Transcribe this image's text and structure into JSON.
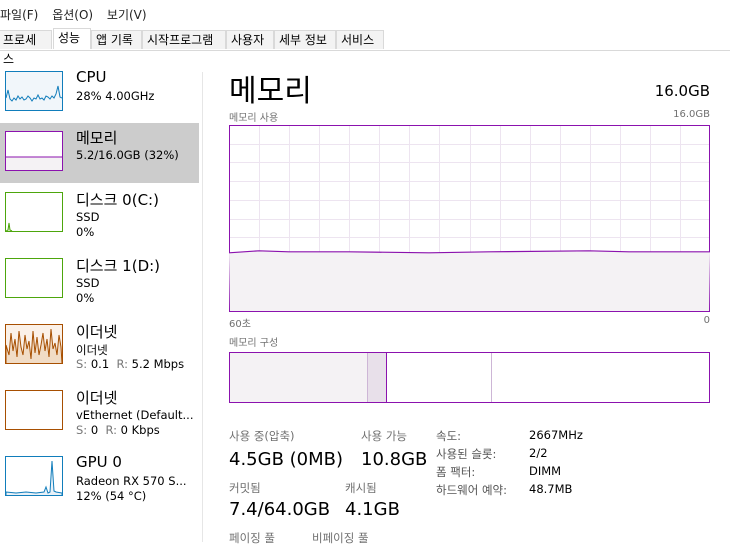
{
  "menu": [
    "파일(F)",
    "옵션(O)",
    "보기(V)"
  ],
  "tabs": [
    "프로세스",
    "성능",
    "앱 기록",
    "시작프로그램",
    "사용자",
    "세부 정보",
    "서비스"
  ],
  "sidebar": {
    "cpu": {
      "title": "CPU",
      "line1": "28%  4.00GHz"
    },
    "memory": {
      "title": "메모리",
      "line1": "5.2/16.0GB (32%)"
    },
    "disk0": {
      "title": "디스크 0(C:)",
      "line1": "SSD",
      "line2": "0%"
    },
    "disk1": {
      "title": "디스크 1(D:)",
      "line1": "SSD",
      "line2": "0%"
    },
    "eth1": {
      "title": "이더넷",
      "line1": "이더넷",
      "s_label": "S:",
      "s_val": "0.1",
      "r_label": "R:",
      "r_val": "5.2 Mbps"
    },
    "eth2": {
      "title": "이더넷",
      "line1": "vEthernet (Default...",
      "s_label": "S:",
      "s_val": "0",
      "r_label": "R:",
      "r_val": "0 Kbps"
    },
    "gpu": {
      "title": "GPU 0",
      "line1": "Radeon RX 570 S...",
      "line2": "12% (54 °C)"
    }
  },
  "main": {
    "title": "메모리",
    "total": "16.0GB",
    "usage_label": "메모리 사용",
    "usage_max": "16.0GB",
    "time_left": "60초",
    "time_right": "0",
    "composition_label": "메모리 구성",
    "usage_fraction": 0.32
  },
  "stats": {
    "in_use_label": "사용 중(압축)",
    "in_use_value": "4.5GB (0MB)",
    "available_label": "사용 가능",
    "available_value": "10.8GB",
    "committed_label": "커밋됨",
    "committed_value": "7.4/64.0GB",
    "cached_label": "캐시됨",
    "cached_value": "4.1GB",
    "paged_pool_label": "페이징 풀",
    "nonpaged_pool_label": "비페이징 풀"
  },
  "details": {
    "speed_label": "속도:",
    "speed_value": "2667MHz",
    "slots_label": "사용된 슬롯:",
    "slots_value": "2/2",
    "form_label": "폼 팩터:",
    "form_value": "DIMM",
    "reserved_label": "하드웨어 예약:",
    "reserved_value": "48.7MB"
  },
  "colors": {
    "memory": "#8b12ae",
    "cpu": "#117dbb",
    "disk": "#4da60c",
    "ethernet": "#a74f01"
  }
}
